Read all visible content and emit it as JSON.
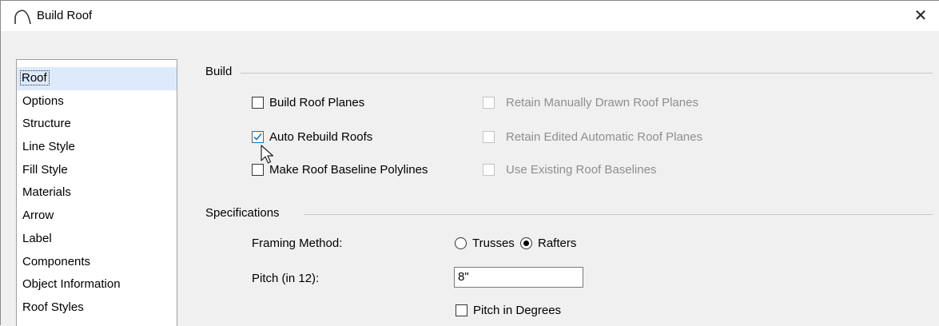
{
  "window": {
    "title": "Build Roof",
    "close_label": "✕"
  },
  "sidebar": {
    "items": [
      {
        "label": "Roof",
        "selected": true
      },
      {
        "label": "Options"
      },
      {
        "label": "Structure"
      },
      {
        "label": "Line Style"
      },
      {
        "label": "Fill Style"
      },
      {
        "label": "Materials"
      },
      {
        "label": "Arrow"
      },
      {
        "label": "Label"
      },
      {
        "label": "Components"
      },
      {
        "label": "Object Information"
      },
      {
        "label": "Roof Styles"
      }
    ]
  },
  "build": {
    "heading": "Build",
    "build_roof_planes": {
      "label": "Build Roof Planes",
      "checked": false
    },
    "auto_rebuild_roofs": {
      "label": "Auto Rebuild Roofs",
      "checked": true
    },
    "make_baseline_polylines": {
      "label": "Make Roof Baseline Polylines",
      "checked": false
    },
    "retain_manual_planes": {
      "label": "Retain Manually Drawn Roof Planes",
      "checked": false,
      "disabled": true
    },
    "retain_edited_planes": {
      "label": "Retain Edited Automatic Roof Planes",
      "checked": false,
      "disabled": true
    },
    "use_existing_baselines": {
      "label": "Use Existing Roof Baselines",
      "checked": false,
      "disabled": true
    }
  },
  "specifications": {
    "heading": "Specifications",
    "framing_method_label": "Framing Method:",
    "framing_options": [
      "Trusses",
      "Rafters"
    ],
    "framing_selected": "Rafters",
    "pitch_label": "Pitch (in 12):",
    "pitch_value": "8\"",
    "pitch_in_degrees": {
      "label": "Pitch in Degrees",
      "checked": false
    }
  },
  "colors": {
    "selection": "#dceafc",
    "check_accent": "#0078d7",
    "disabled_text": "#8e8e8e",
    "panel_bg": "#f0f0f0"
  }
}
